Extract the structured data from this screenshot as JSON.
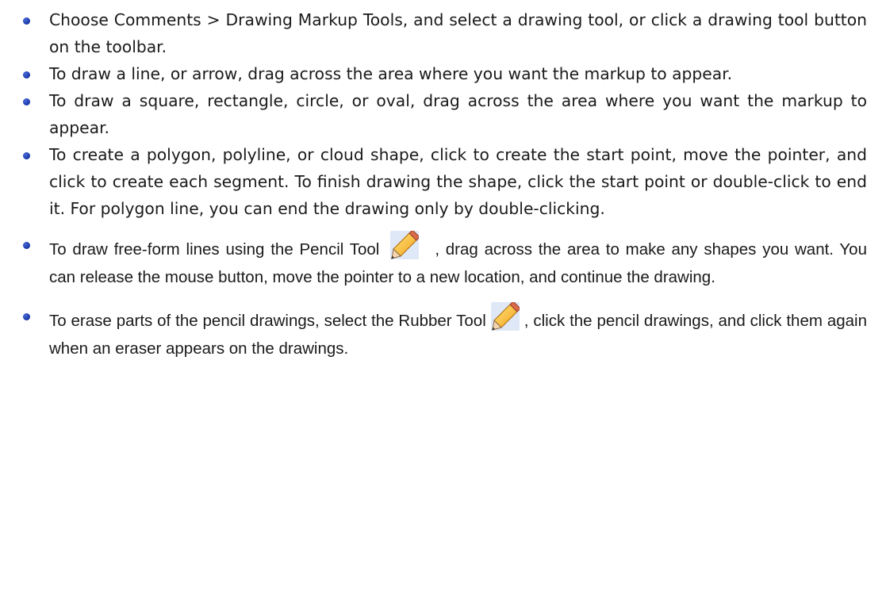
{
  "items": [
    {
      "text": "Choose Comments > Drawing Markup Tools, and select a drawing tool, or click a drawing tool button on the toolbar."
    },
    {
      "text": "To draw a line, or arrow, drag across the area where you want the markup to appear."
    },
    {
      "text": "To draw a square, rectangle, circle, or oval, drag across the area where you want the markup to appear."
    },
    {
      "text": "To create a polygon, polyline, or cloud shape, click to create the start point, move the pointer, and click to create each segment. To finish drawing the shape, click the start point or double-click to end it. For polygon line, you can end the drawing only by double-clicking."
    },
    {
      "text_before": "To draw free-form lines using the Pencil Tool",
      "text_after": ", drag across the area to make any shapes you want. You can release the mouse button, move the pointer to a new location, and continue the drawing.",
      "icon": "pencil-icon"
    },
    {
      "text_before": "To erase parts of the pencil drawings, select the Rubber Tool",
      "text_after": ", click the pencil drawings, and click them again when an eraser appears on the drawings.",
      "icon": "pencil-icon"
    }
  ]
}
